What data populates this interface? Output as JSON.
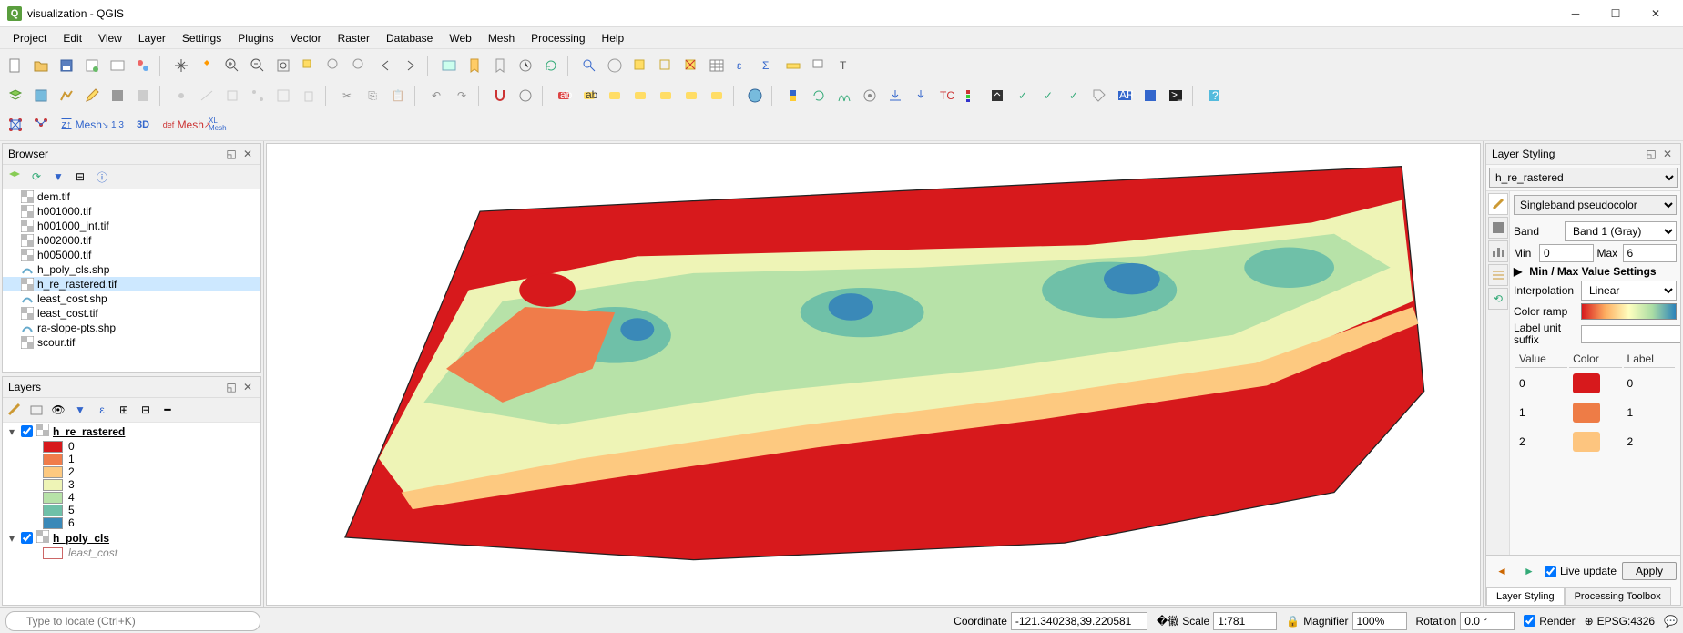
{
  "window": {
    "title": "visualization - QGIS"
  },
  "menu": [
    "Project",
    "Edit",
    "View",
    "Layer",
    "Settings",
    "Plugins",
    "Vector",
    "Raster",
    "Database",
    "Web",
    "Mesh",
    "Processing",
    "Help"
  ],
  "mesh_toolbar": [
    "Mesh",
    "1 3",
    "3D",
    "def",
    "Mesh",
    "XL Mesh"
  ],
  "browser": {
    "title": "Browser",
    "items": [
      {
        "name": "dem.tif",
        "icon": "raster"
      },
      {
        "name": "h001000.tif",
        "icon": "raster"
      },
      {
        "name": "h001000_int.tif",
        "icon": "raster"
      },
      {
        "name": "h002000.tif",
        "icon": "raster"
      },
      {
        "name": "h005000.tif",
        "icon": "raster"
      },
      {
        "name": "h_poly_cls.shp",
        "icon": "vector"
      },
      {
        "name": "h_re_rastered.tif",
        "icon": "raster",
        "selected": true
      },
      {
        "name": "least_cost.shp",
        "icon": "vector"
      },
      {
        "name": "least_cost.tif",
        "icon": "raster"
      },
      {
        "name": "ra-slope-pts.shp",
        "icon": "vector"
      },
      {
        "name": "scour.tif",
        "icon": "raster"
      }
    ]
  },
  "layers": {
    "title": "Layers",
    "groups": [
      {
        "name": "h_re_rastered",
        "checked": true,
        "expanded": true,
        "legend": [
          {
            "v": "0",
            "c": "#d7191c"
          },
          {
            "v": "1",
            "c": "#f07c4a"
          },
          {
            "v": "2",
            "c": "#fdc980"
          },
          {
            "v": "3",
            "c": "#eef4b6"
          },
          {
            "v": "4",
            "c": "#b7e2a8"
          },
          {
            "v": "5",
            "c": "#6fc0a8"
          },
          {
            "v": "6",
            "c": "#3a89b8"
          }
        ]
      },
      {
        "name": "h_poly_cls",
        "checked": true,
        "expanded": true,
        "sub": "least_cost"
      }
    ]
  },
  "styling": {
    "title": "Layer Styling",
    "layer": "h_re_rastered",
    "renderer": "Singleband pseudocolor",
    "band_label": "Band",
    "band": "Band 1 (Gray)",
    "min_label": "Min",
    "min": "0",
    "max_label": "Max",
    "max": "6",
    "minmax_header": "Min / Max Value Settings",
    "interp_label": "Interpolation",
    "interp": "Linear",
    "ramp_label": "Color ramp",
    "suffix_label": "Label unit suffix",
    "suffix": "",
    "table_headers": [
      "Value",
      "Color",
      "Label"
    ],
    "classes": [
      {
        "value": "0",
        "color": "#d7191c",
        "label": "0"
      },
      {
        "value": "1",
        "color": "#ee7c46",
        "label": "1"
      },
      {
        "value": "2",
        "color": "#fdc57f",
        "label": "2"
      }
    ],
    "live_update": "Live update",
    "apply": "Apply",
    "tabs": [
      "Layer Styling",
      "Processing Toolbox"
    ]
  },
  "status": {
    "locator_placeholder": "Type to locate (Ctrl+K)",
    "coord_label": "Coordinate",
    "coord": "-121.340238,39.220581",
    "scale_label": "Scale",
    "scale": "1:781",
    "mag_label": "Magnifier",
    "mag": "100%",
    "rot_label": "Rotation",
    "rot": "0.0 °",
    "render": "Render",
    "crs": "EPSG:4326"
  },
  "colors": {
    "c0": "#d7191c",
    "c1": "#f07c4a",
    "c2": "#fdc980",
    "c3": "#eef4b6",
    "c4": "#b7e2a8",
    "c5": "#6fc0a8",
    "c6": "#3a89b8"
  }
}
